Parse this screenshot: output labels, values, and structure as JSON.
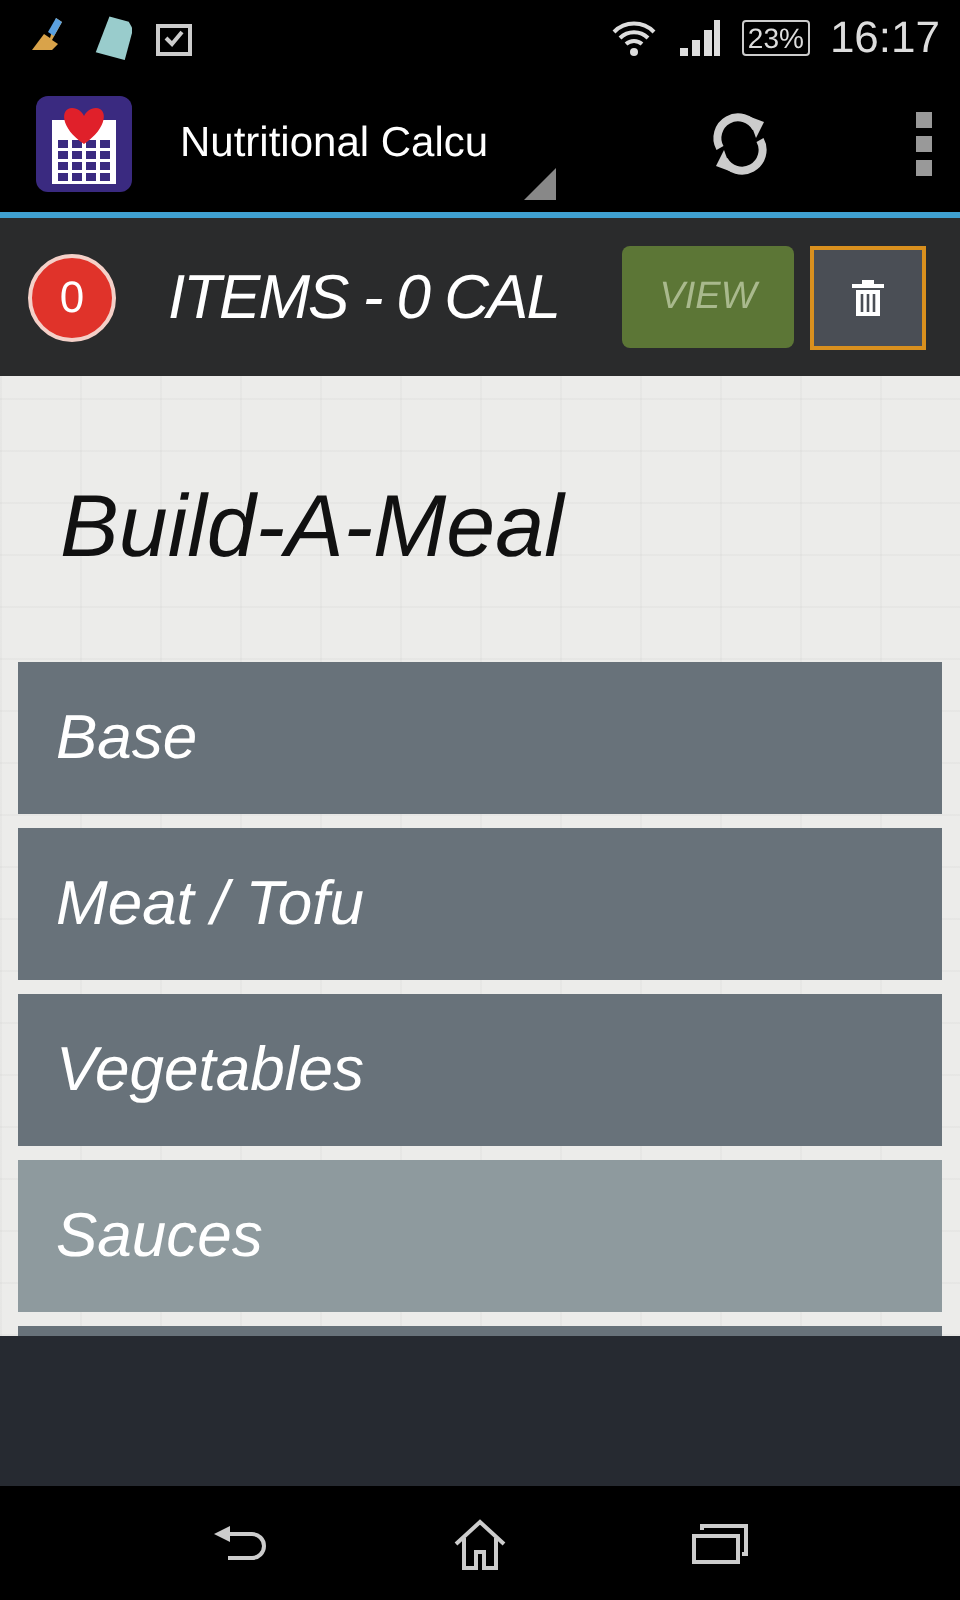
{
  "status_bar": {
    "battery": "23%",
    "time": "16:17"
  },
  "action_bar": {
    "title": "Nutritional Calcu"
  },
  "summary": {
    "count": "0",
    "text": "ITEMS - 0 CAL",
    "view_button": "VIEW"
  },
  "heading": "Build-A-Meal",
  "categories": [
    {
      "label": "Base",
      "selected": false
    },
    {
      "label": "Meat / Tofu",
      "selected": false
    },
    {
      "label": "Vegetables",
      "selected": false
    },
    {
      "label": "Sauces",
      "selected": true
    }
  ]
}
